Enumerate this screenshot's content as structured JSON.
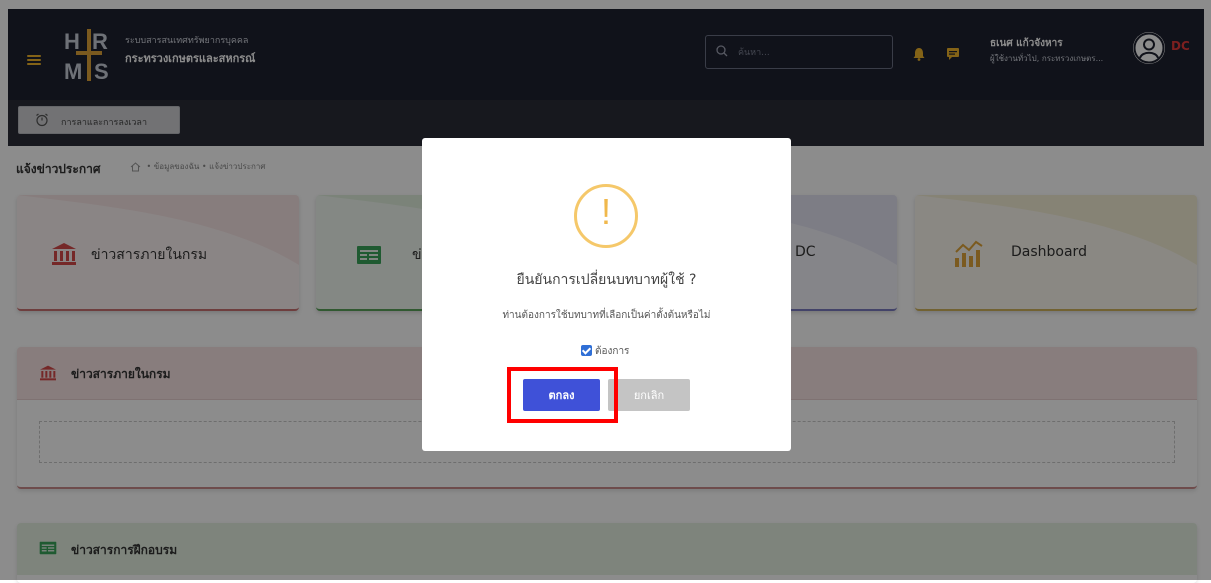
{
  "header": {
    "system_name": "ระบบสารสนเทศทรัพยากรบุคคล",
    "org_name": "กระทรวงเกษตรและสหกรณ์",
    "search_placeholder": "ค้นหา...",
    "user_name": "ธเนศ แก้วจังหาร",
    "user_role": "ผู้ใช้งานทั่วไป, กระทรวงเกษตร...",
    "badge": "DC"
  },
  "subbar": {
    "attendance_label": "การลาและการลงเวลา"
  },
  "page": {
    "title": "แจ้งข่าวประกาศ",
    "breadcrumb": "• ข้อมูลของฉัน • แจ้งข่าวประกาศ"
  },
  "cards": [
    {
      "label": "ข่าวสารภายในกรม",
      "icon": "bank-icon"
    },
    {
      "label": "ข่",
      "icon": "news-icon"
    },
    {
      "label": "DC",
      "icon": ""
    },
    {
      "label": "Dashboard",
      "icon": "chart-icon"
    }
  ],
  "sections": [
    {
      "title": "ข่าวสารภายในกรม",
      "icon": "bank-icon"
    },
    {
      "title": "ข่าวสารการฝึกอบรม",
      "icon": "news-icon"
    }
  ],
  "modal": {
    "icon": "!",
    "title": "ยืนยันการเปลี่ยนบทบาทผู้ใช้ ?",
    "text": "ท่านต้องการใช้บทบาทที่เลือกเป็นค่าตั้งต้นหรือไม่",
    "checkbox_label": "ต้องการ",
    "checkbox_checked": true,
    "ok_label": "ตกลง",
    "cancel_label": "ยกเลิก"
  },
  "colors": {
    "header": "#1e2130",
    "accent": "#3f51d8",
    "warning": "#f5c86a",
    "highlight": "#ff0000"
  }
}
